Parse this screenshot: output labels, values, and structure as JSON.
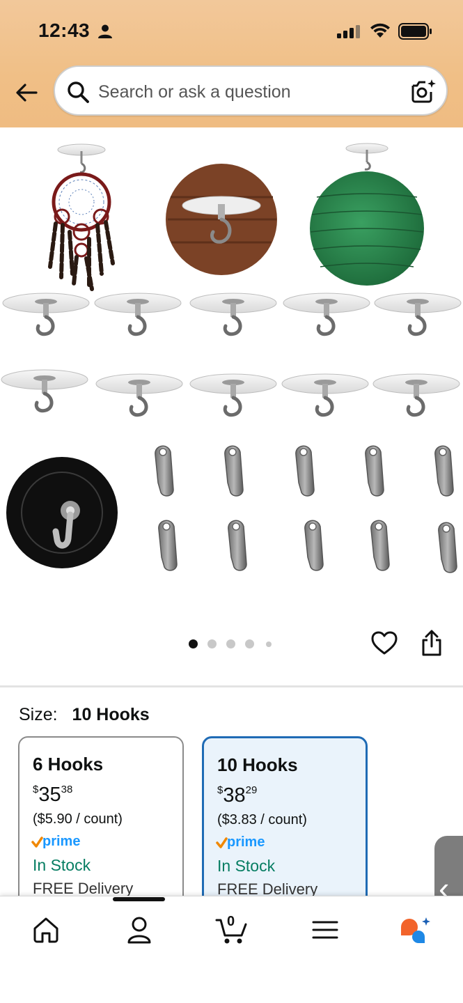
{
  "status_bar": {
    "time": "12:43"
  },
  "search": {
    "placeholder": "Search or ask a question"
  },
  "gallery": {
    "page_count": 5,
    "active_page": 0
  },
  "size": {
    "label": "Size:",
    "selected": "10 Hooks",
    "options": [
      {
        "name": "6 Hooks",
        "price_symbol": "$",
        "price_whole": "35",
        "price_fraction": "38",
        "unit_price": "($5.90 / count)",
        "prime": "prime",
        "stock": "In Stock",
        "delivery": "FREE Delivery",
        "selected": false
      },
      {
        "name": "10 Hooks",
        "price_symbol": "$",
        "price_whole": "38",
        "price_fraction": "29",
        "unit_price": "($3.83 / count)",
        "prime": "prime",
        "stock": "In Stock",
        "delivery": "FREE Delivery",
        "selected": true
      }
    ]
  },
  "bottom_nav": {
    "cart_count": "0"
  },
  "colors": {
    "header": "#f0bf86",
    "accent_blue": "#1f6bb5",
    "stock_green": "#067d62",
    "prime_blue": "#1a98ff",
    "prime_check": "#f08804"
  }
}
